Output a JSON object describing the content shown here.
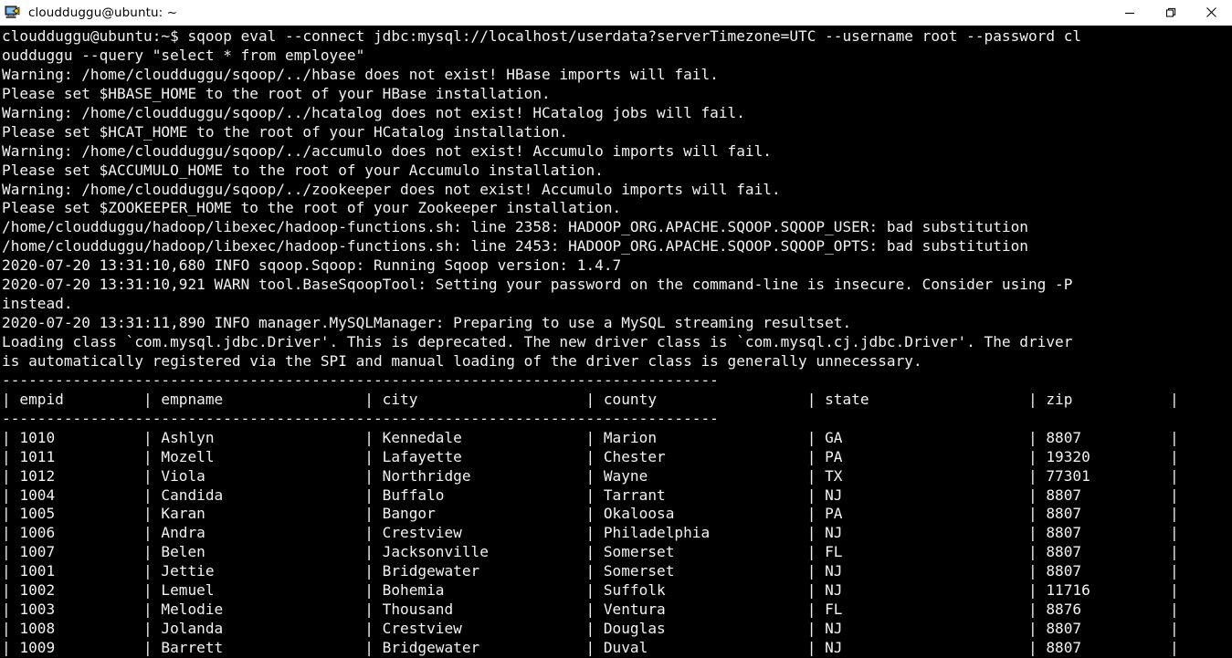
{
  "window": {
    "title": "cloudduggu@ubuntu: ~",
    "icon": "putty-terminal-icon",
    "controls": {
      "minimize_label": "Minimize",
      "maximize_label": "Maximize",
      "close_label": "Close"
    },
    "background_color": "#000000",
    "text_color": "#f2f2f2",
    "titlebar_color": "#ffffff"
  },
  "terminal": {
    "prompt": "cloudduggu@ubuntu:~$",
    "command": "sqoop eval --connect jdbc:mysql://localhost/userdata?serverTimezone=UTC --username root --password cloudduggu --query \"select * from employee\"",
    "output_lines": [
      "cloudduggu@ubuntu:~$ sqoop eval --connect jdbc:mysql://localhost/userdata?serverTimezone=UTC --username root --password cl",
      "oudduggu --query \"select * from employee\"",
      "Warning: /home/cloudduggu/sqoop/../hbase does not exist! HBase imports will fail.",
      "Please set $HBASE_HOME to the root of your HBase installation.",
      "Warning: /home/cloudduggu/sqoop/../hcatalog does not exist! HCatalog jobs will fail.",
      "Please set $HCAT_HOME to the root of your HCatalog installation.",
      "Warning: /home/cloudduggu/sqoop/../accumulo does not exist! Accumulo imports will fail.",
      "Please set $ACCUMULO_HOME to the root of your Accumulo installation.",
      "Warning: /home/cloudduggu/sqoop/../zookeeper does not exist! Accumulo imports will fail.",
      "Please set $ZOOKEEPER_HOME to the root of your Zookeeper installation.",
      "/home/cloudduggu/hadoop/libexec/hadoop-functions.sh: line 2358: HADOOP_ORG.APACHE.SQOOP.SQOOP_USER: bad substitution",
      "/home/cloudduggu/hadoop/libexec/hadoop-functions.sh: line 2453: HADOOP_ORG.APACHE.SQOOP.SQOOP_OPTS: bad substitution",
      "2020-07-20 13:31:10,680 INFO sqoop.Sqoop: Running Sqoop version: 1.4.7",
      "2020-07-20 13:31:10,921 WARN tool.BaseSqoopTool: Setting your password on the command-line is insecure. Consider using -P",
      "instead.",
      "2020-07-20 13:31:11,890 INFO manager.MySQLManager: Preparing to use a MySQL streaming resultset.",
      "Loading class `com.mysql.jdbc.Driver'. This is deprecated. The new driver class is `com.mysql.cj.jdbc.Driver'. The driver",
      "is automatically registered via the SPI and manual loading of the driver class is generally unnecessary."
    ]
  },
  "result_table": {
    "separator_char": "-",
    "separator_width": 81,
    "columns": [
      {
        "name": "empid",
        "header": "empid",
        "width": 16
      },
      {
        "name": "empname",
        "header": "empname",
        "width": 25
      },
      {
        "name": "city",
        "header": "city",
        "width": 25
      },
      {
        "name": "county",
        "header": "county",
        "width": 25
      },
      {
        "name": "state",
        "header": "state",
        "width": 25
      },
      {
        "name": "zip",
        "header": "zip",
        "width": 16
      }
    ],
    "rows": [
      {
        "empid": "1010",
        "empname": "Ashlyn",
        "city": "Kennedale",
        "county": "Marion",
        "state": "GA",
        "zip": "8807"
      },
      {
        "empid": "1011",
        "empname": "Mozell",
        "city": "Lafayette",
        "county": "Chester",
        "state": "PA",
        "zip": "19320"
      },
      {
        "empid": "1012",
        "empname": "Viola",
        "city": "Northridge",
        "county": "Wayne",
        "state": "TX",
        "zip": "77301"
      },
      {
        "empid": "1004",
        "empname": "Candida",
        "city": "Buffalo",
        "county": "Tarrant",
        "state": "NJ",
        "zip": "8807"
      },
      {
        "empid": "1005",
        "empname": "Karan",
        "city": "Bangor",
        "county": "Okaloosa",
        "state": "PA",
        "zip": "8807"
      },
      {
        "empid": "1006",
        "empname": "Andra",
        "city": "Crestview",
        "county": "Philadelphia",
        "state": "NJ",
        "zip": "8807"
      },
      {
        "empid": "1007",
        "empname": "Belen",
        "city": "Jacksonville",
        "county": "Somerset",
        "state": "FL",
        "zip": "8807"
      },
      {
        "empid": "1001",
        "empname": "Jettie",
        "city": "Bridgewater",
        "county": "Somerset",
        "state": "NJ",
        "zip": "8807"
      },
      {
        "empid": "1002",
        "empname": "Lemuel",
        "city": "Bohemia",
        "county": "Suffolk",
        "state": "NJ",
        "zip": "11716"
      },
      {
        "empid": "1003",
        "empname": "Melodie",
        "city": "Thousand",
        "county": "Ventura",
        "state": "FL",
        "zip": "8876"
      },
      {
        "empid": "1008",
        "empname": "Jolanda",
        "city": "Crestview",
        "county": "Douglas",
        "state": "NJ",
        "zip": "8807"
      },
      {
        "empid": "1009",
        "empname": "Barrett",
        "city": "Bridgewater",
        "county": "Duval",
        "state": "NJ",
        "zip": "8807"
      }
    ]
  }
}
